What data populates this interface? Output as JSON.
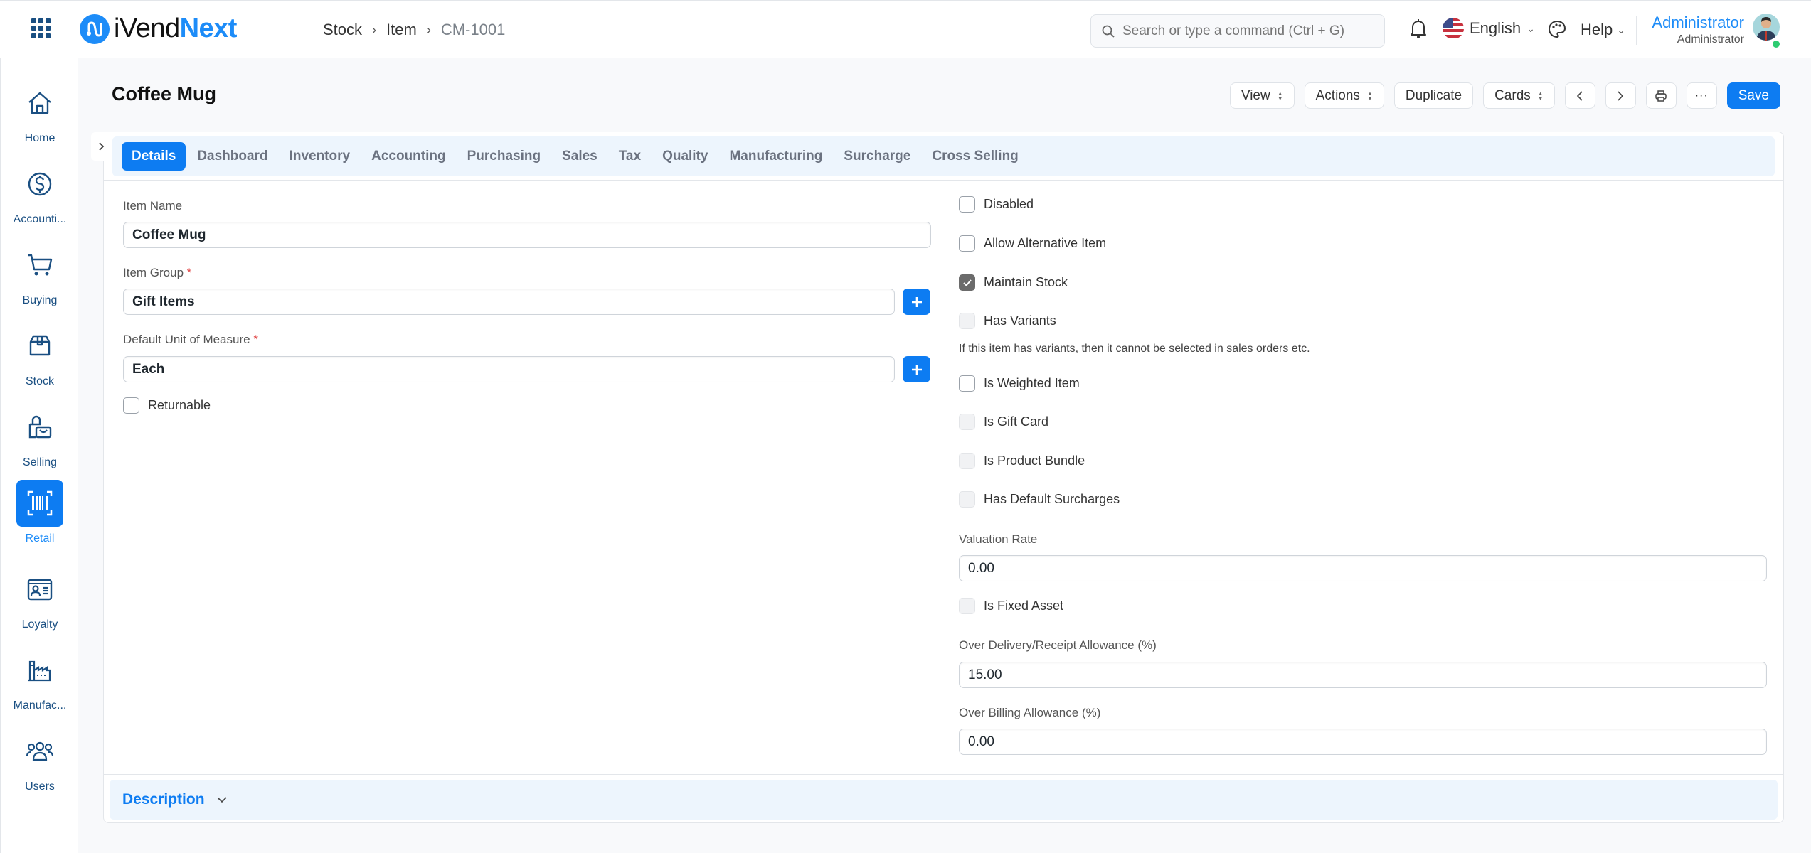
{
  "app": {
    "brand_a": "iVend",
    "brand_b": "Next",
    "breadcrumb": [
      "Stock",
      "Item",
      "CM-1001"
    ],
    "search_placeholder": "Search or type a command (Ctrl + G)",
    "language": "English",
    "help": "Help",
    "user_name": "Administrator",
    "user_role": "Administrator"
  },
  "sidebar": {
    "items": [
      {
        "label": "Home",
        "icon": "home-icon"
      },
      {
        "label": "Accounti...",
        "icon": "dollar-icon"
      },
      {
        "label": "Buying",
        "icon": "cart-icon"
      },
      {
        "label": "Stock",
        "icon": "box-icon"
      },
      {
        "label": "Selling",
        "icon": "shopping-bag-icon"
      },
      {
        "label": "Retail",
        "icon": "barcode-icon",
        "active": true
      },
      {
        "label": "Loyalty",
        "icon": "id-card-icon"
      },
      {
        "label": "Manufac...",
        "icon": "factory-icon"
      },
      {
        "label": "Users",
        "icon": "users-icon"
      }
    ]
  },
  "page": {
    "title": "Coffee Mug",
    "toolbar": {
      "view": "View",
      "actions": "Actions",
      "duplicate": "Duplicate",
      "cards": "Cards",
      "save": "Save"
    }
  },
  "tabs": [
    "Details",
    "Dashboard",
    "Inventory",
    "Accounting",
    "Purchasing",
    "Sales",
    "Tax",
    "Quality",
    "Manufacturing",
    "Surcharge",
    "Cross Selling"
  ],
  "active_tab": "Details",
  "form": {
    "item_name": {
      "label": "Item Name",
      "value": "Coffee Mug"
    },
    "item_group": {
      "label": "Item Group",
      "value": "Gift Items",
      "required": "*"
    },
    "uom": {
      "label": "Default Unit of Measure",
      "value": "Each",
      "required": "*"
    },
    "returnable": {
      "label": "Returnable",
      "checked": false
    },
    "checks": [
      {
        "label": "Disabled",
        "checked": false,
        "disabled": false
      },
      {
        "label": "Allow Alternative Item",
        "checked": false,
        "disabled": false
      },
      {
        "label": "Maintain Stock",
        "checked": true,
        "disabled": false
      },
      {
        "label": "Has Variants",
        "checked": false,
        "disabled": true
      },
      {
        "label": "Is Weighted Item",
        "checked": false,
        "disabled": false
      },
      {
        "label": "Is Gift Card",
        "checked": false,
        "disabled": true
      },
      {
        "label": "Is Product Bundle",
        "checked": false,
        "disabled": true
      },
      {
        "label": "Has Default Surcharges",
        "checked": false,
        "disabled": true
      }
    ],
    "variants_help": "If this item has variants, then it cannot be selected in sales orders etc.",
    "valuation_rate": {
      "label": "Valuation Rate",
      "value": "0.00"
    },
    "fixed_asset": {
      "label": "Is Fixed Asset",
      "checked": false,
      "disabled": true
    },
    "over_delivery": {
      "label": "Over Delivery/Receipt Allowance (%)",
      "value": "15.00"
    },
    "over_billing": {
      "label": "Over Billing Allowance (%)",
      "value": "0.00"
    }
  },
  "sections": {
    "description": "Description"
  },
  "colors": {
    "accent": "#0d7cf2",
    "brand_dark": "#1a4f82",
    "tab_bg": "#edf5fd"
  }
}
